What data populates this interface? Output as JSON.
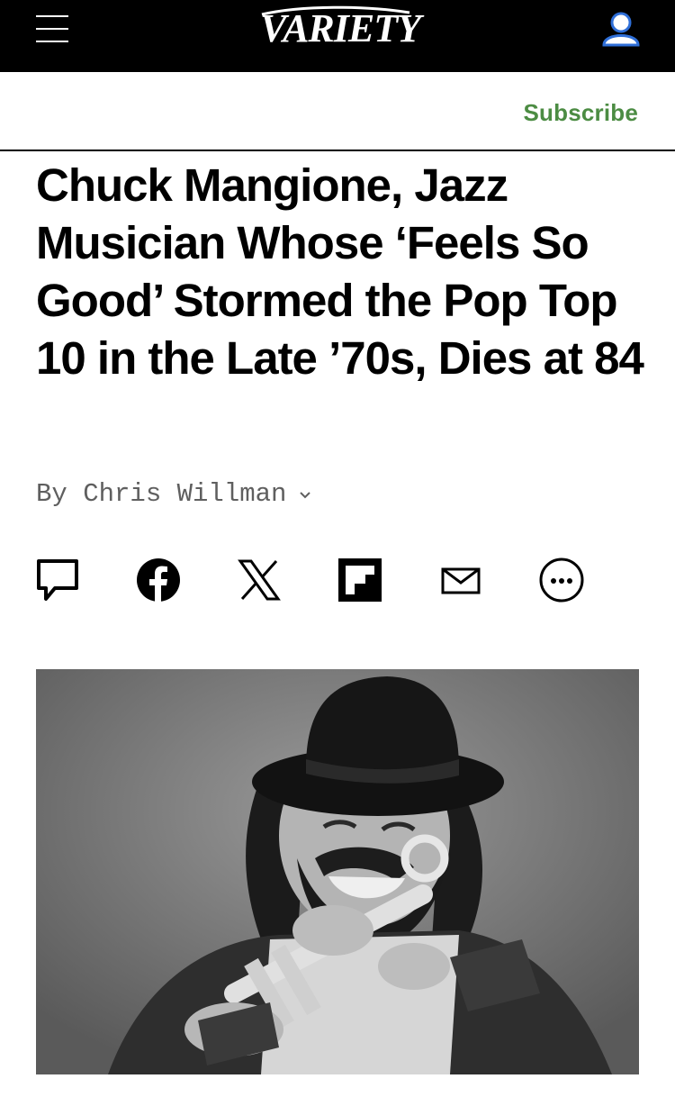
{
  "header": {
    "logo_text": "VARIETY",
    "menu_icon": "hamburger-menu-icon",
    "account_icon": "user-account-icon"
  },
  "subscribe": {
    "label": "Subscribe",
    "color": "#4c8c43"
  },
  "article": {
    "headline": "Chuck Mangione, Jazz Musician Whose ‘Feels So Good’ Stormed the Pop Top 10 in the Late ’70s, Dies at 84",
    "byline": "By Chris Willman"
  },
  "share_icons": [
    "comment-icon",
    "facebook-icon",
    "x-icon",
    "flipboard-icon",
    "email-icon",
    "more-icon"
  ]
}
